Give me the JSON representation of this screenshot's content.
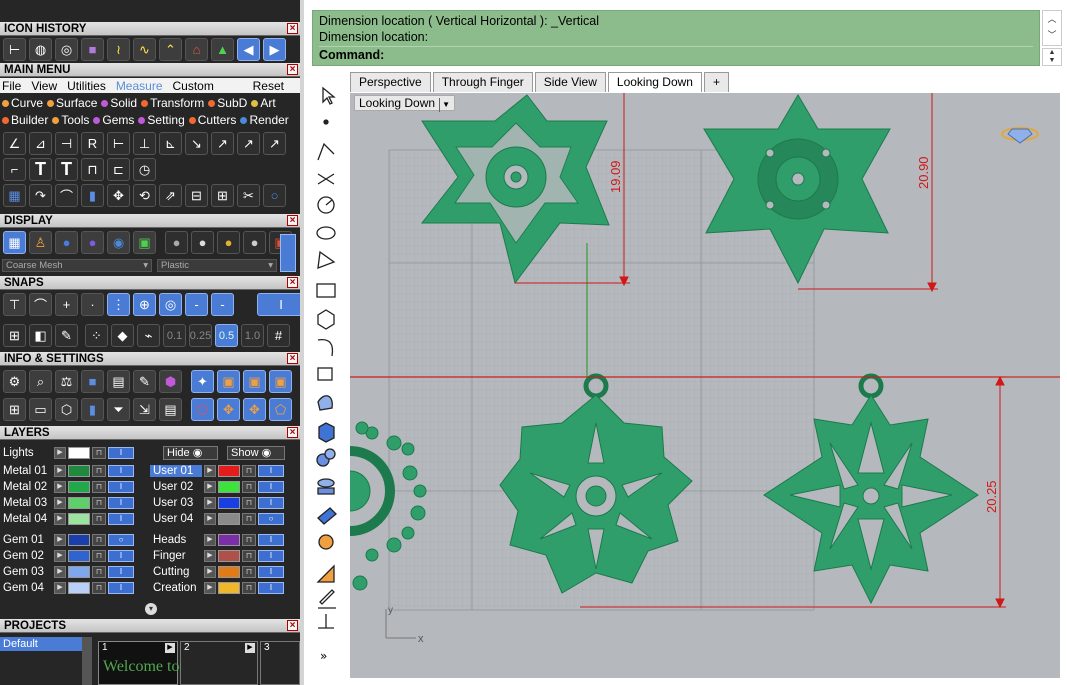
{
  "sections": {
    "icon_history": "ICON HISTORY",
    "main_menu": "MAIN MENU",
    "display": "DISPLAY",
    "snaps": "SNAPS",
    "info_settings": "INFO & SETTINGS",
    "layers": "LAYERS",
    "projects": "PROJECTS"
  },
  "menu": {
    "file": "File",
    "view": "View",
    "utilities": "Utilities",
    "measure": "Measure",
    "custom": "Custom",
    "reset": "Reset"
  },
  "toolbar_row1": [
    "Curve",
    "Surface",
    "Solid",
    "Transform",
    "SubD",
    "Art"
  ],
  "toolbar_row2": [
    "Builder",
    "Tools",
    "Gems",
    "Setting",
    "Cutters",
    "Render"
  ],
  "display": {
    "mesh": "Coarse Mesh",
    "material": "Plastic"
  },
  "snaps_values": [
    "0.1",
    "0.25",
    "0.5",
    "1.0"
  ],
  "layers": {
    "lights": "Lights",
    "hide": "Hide",
    "show": "Show",
    "left": [
      {
        "name": "Metal 01",
        "color": "#1f8a3e"
      },
      {
        "name": "Metal 02",
        "color": "#22a84a"
      },
      {
        "name": "Metal 03",
        "color": "#5fcf6c"
      },
      {
        "name": "Metal 04",
        "color": "#9be39f"
      },
      {
        "name": "Gem 01",
        "color": "#1b3faa"
      },
      {
        "name": "Gem 02",
        "color": "#2f63cf"
      },
      {
        "name": "Gem 03",
        "color": "#7fa7ee"
      },
      {
        "name": "Gem 04",
        "color": "#b9cff7"
      }
    ],
    "right": [
      {
        "name": "User 01",
        "color": "#e51c1c"
      },
      {
        "name": "User 02",
        "color": "#3de23d"
      },
      {
        "name": "User 03",
        "color": "#1a3fe0"
      },
      {
        "name": "User 04",
        "color": "#8a8a8a"
      },
      {
        "name": "Heads",
        "color": "#7a2ea8"
      },
      {
        "name": "Finger",
        "color": "#b0504a"
      },
      {
        "name": "Cutting",
        "color": "#e07b16"
      },
      {
        "name": "Creation",
        "color": "#f0b72a"
      }
    ]
  },
  "projects": {
    "default": "Default",
    "p1": "1",
    "p2": "2",
    "p3": "3",
    "thumb": "Welcome to"
  },
  "command": {
    "line1": "Dimension location ( Vertical  Horizontal ): _Vertical",
    "line2": "Dimension location:",
    "line3": "Command:"
  },
  "tabs": [
    "Perspective",
    "Through Finger",
    "Side View",
    "Looking Down",
    "+"
  ],
  "viewport": {
    "label": "Looking Down",
    "dims": {
      "d1": "19.09",
      "d2": "20.90",
      "d3": "20.25"
    },
    "axis_y": "y",
    "axis_x": "x"
  },
  "colors": {
    "model": "#2f9e6a",
    "dim": "#d01818"
  }
}
